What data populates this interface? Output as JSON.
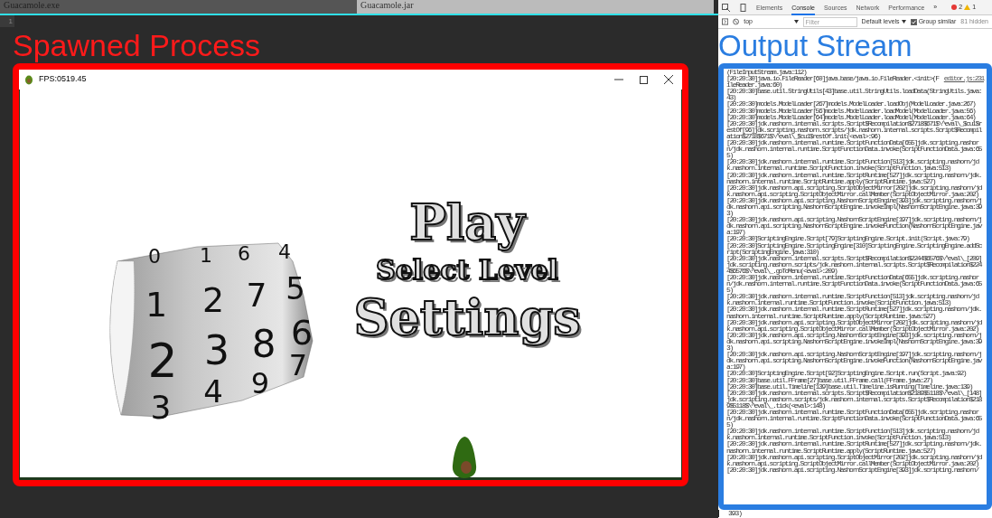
{
  "editor": {
    "tabs": [
      {
        "label": "Guacamole.exe",
        "selected": true
      },
      {
        "label": "Guacamole.jar",
        "selected": false
      }
    ],
    "line_numbers": [
      "1"
    ]
  },
  "left_label": "Spawned Process",
  "game_window": {
    "title": "FPS:0519.45",
    "drum": [
      [
        "0",
        "1",
        "6",
        "4"
      ],
      [
        "1",
        "2",
        "7",
        "5"
      ],
      [
        "2",
        "3",
        "8",
        "6"
      ],
      [
        "3",
        "4",
        "9",
        "7"
      ]
    ],
    "menu": [
      "Play",
      "Select Level",
      "Settings"
    ]
  },
  "devtools": {
    "tabs": [
      {
        "label": "Elements",
        "selected": false
      },
      {
        "label": "Console",
        "selected": true
      },
      {
        "label": "Sources",
        "selected": false
      },
      {
        "label": "Network",
        "selected": false
      },
      {
        "label": "Performance",
        "selected": false
      }
    ],
    "more": "»",
    "errors": "2",
    "warnings": "1",
    "context": "top",
    "filter": {
      "placeholder": "Filter"
    },
    "levels": "Default levels",
    "group_similar": {
      "label": "Group similar",
      "checked": true
    },
    "hidden": "81 hidden"
  },
  "right_label": "Output Stream",
  "console": {
    "lines": [
      {
        "text": "(FileInputStream.java:112)"
      },
      {
        "text": "[20:20:30]java.io.FileReader[60]java.base/java.io.FileReader.<init>(FileReader.java:60)",
        "source": "editor.js:231"
      },
      {
        "text": "[20:20:30]base.util.StringUtils[43]base.util.StringUtils.loadData(StringUtils.java:43)"
      },
      {
        "text": "[20:20:30]models.ModelLoader[267]models.ModelLoader.loadObj(ModelLoader.java:267)"
      },
      {
        "text": "[20:20:30]models.ModelLoader[56]models.ModelLoader.loadModel(ModelLoader.java:56)"
      },
      {
        "text": "[20:20:30]models.ModelLoader[64]models.ModelLoader.loadModel(ModelLoader.java:64)"
      },
      {
        "text": "[20:20:30]jdk.nashorn.internal.scripts.Script$Recompilation$2718$671$\\^eval\\_$cu1$restOf[96]jdk.scripting.nashorn.scripts/jdk.nashorn.internal.scripts.Script$Recompilation$2718$671$\\^eval\\_$cu1$restOf.init(<eval>:96)"
      },
      {
        "text": "[20:20:30]jdk.nashorn.internal.runtime.ScriptFunctionData[655]jdk.scripting.nashorn/jdk.nashorn.internal.runtime.ScriptFunctionData.invoke(ScriptFunctionData.java:655)"
      },
      {
        "text": "[20:20:30]jdk.nashorn.internal.runtime.ScriptFunction[513]jdk.scripting.nashorn/jdk.nashorn.internal.runtime.ScriptFunction.invoke(ScriptFunction.java:513)"
      },
      {
        "text": "[20:20:30]jdk.nashorn.internal.runtime.ScriptRuntime[527]jdk.scripting.nashorn/jdk.nashorn.internal.runtime.ScriptRuntime.apply(ScriptRuntime.java:527)"
      },
      {
        "text": "[20:20:30]jdk.nashorn.api.scripting.ScriptObjectMirror[202]jdk.scripting.nashorn/jdk.nashorn.api.scripting.ScriptObjectMirror.callMember(ScriptObjectMirror.java:202)"
      },
      {
        "text": "[20:20:30]jdk.nashorn.api.scripting.NashornScriptEngine[393]jdk.scripting.nashorn/jdk.nashorn.api.scripting.NashornScriptEngine.invokeImpl(NashornScriptEngine.java:393)"
      },
      {
        "text": "[20:20:30]jdk.nashorn.api.scripting.NashornScriptEngine[197]jdk.scripting.nashorn/jdk.nashorn.api.scripting.NashornScriptEngine.invokeFunction(NashornScriptEngine.java:197)"
      },
      {
        "text": "[20:20:30]ScriptingEngine.Script[79]ScriptingEngine.Script.init(Script.java:79)"
      },
      {
        "text": "[20:20:30]ScriptingEngine.ScriptingEngine[310]ScriptingEngine.ScriptingEngine.addScript(ScriptingEngine.java:310)"
      },
      {
        "text": "[20:20:30]jdk.nashorn.internal.scripts.Script$Recompilation$2244$6576$\\^eval\\_[209]jdk.scripting.nashorn.scripts/jdk.nashorn.internal.scripts.Script$Recompilation$2244$6576$\\^eval\\_.goToMenu(<eval>:209)"
      },
      {
        "text": "[20:20:30]jdk.nashorn.internal.runtime.ScriptFunctionData[655]jdk.scripting.nashorn/jdk.nashorn.internal.runtime.ScriptFunctionData.invoke(ScriptFunctionData.java:655)"
      },
      {
        "text": "[20:20:30]jdk.nashorn.internal.runtime.ScriptFunction[513]jdk.scripting.nashorn/jdk.nashorn.internal.runtime.ScriptFunction.invoke(ScriptFunction.java:513)"
      },
      {
        "text": "[20:20:30]jdk.nashorn.internal.runtime.ScriptRuntime[527]jdk.scripting.nashorn/jdk.nashorn.internal.runtime.ScriptRuntime.apply(ScriptRuntime.java:527)"
      },
      {
        "text": "[20:20:30]jdk.nashorn.api.scripting.ScriptObjectMirror[202]jdk.scripting.nashorn/jdk.nashorn.api.scripting.ScriptObjectMirror.callMember(ScriptObjectMirror.java:202)"
      },
      {
        "text": "[20:20:30]jdk.nashorn.api.scripting.NashornScriptEngine[393]jdk.scripting.nashorn/jdk.nashorn.api.scripting.NashornScriptEngine.invokeImpl(NashornScriptEngine.java:393)"
      },
      {
        "text": "[20:20:30]jdk.nashorn.api.scripting.NashornScriptEngine[197]jdk.scripting.nashorn/jdk.nashorn.api.scripting.NashornScriptEngine.invokeFunction(NashornScriptEngine.java:197)"
      },
      {
        "text": "[20:20:30]ScriptingEngine.Script[92]ScriptingEngine.Script.run(Script.java:92)"
      },
      {
        "text": "[20:20:30]base.util.FFrame[27]base.util.FFrame.call(FFrame.java:27)"
      },
      {
        "text": "[20:20:30]base.util.Timeline[139]base.util.Timeline.isRunning(Timeline.java:139)"
      },
      {
        "text": "[20:20:30]jdk.nashorn.internal.scripts.Script$Recompilation$2189$5118$\\^eval\\_[148]jdk.scripting.nashorn.scripts/jdk.nashorn.internal.scripts.Script$Recompilation$2189$5118$\\^eval\\_.tick(<eval>:148)"
      },
      {
        "text": "[20:20:30]jdk.nashorn.internal.runtime.ScriptFunctionData[655]jdk.scripting.nashorn/jdk.nashorn.internal.runtime.ScriptFunctionData.invoke(ScriptFunctionData.java:655)"
      },
      {
        "text": "[20:20:30]jdk.nashorn.internal.runtime.ScriptFunction[513]jdk.scripting.nashorn/jdk.nashorn.internal.runtime.ScriptFunction.invoke(ScriptFunction.java:513)"
      },
      {
        "text": "[20:20:30]jdk.nashorn.internal.runtime.ScriptRuntime[527]jdk.scripting.nashorn/jdk.nashorn.internal.runtime.ScriptRuntime.apply(ScriptRuntime.java:527)"
      },
      {
        "text": "[20:20:30]jdk.nashorn.api.scripting.ScriptObjectMirror[202]jdk.scripting.nashorn/jdk.nashorn.api.scripting.ScriptObjectMirror.callMember(ScriptObjectMirror.java:202)"
      },
      {
        "text": "[20:20:30]jdk.nashorn.api.scripting.NashornScriptEngine[393]jdk.scripting.nashorn/"
      }
    ],
    "tail": [
      "393)"
    ]
  }
}
